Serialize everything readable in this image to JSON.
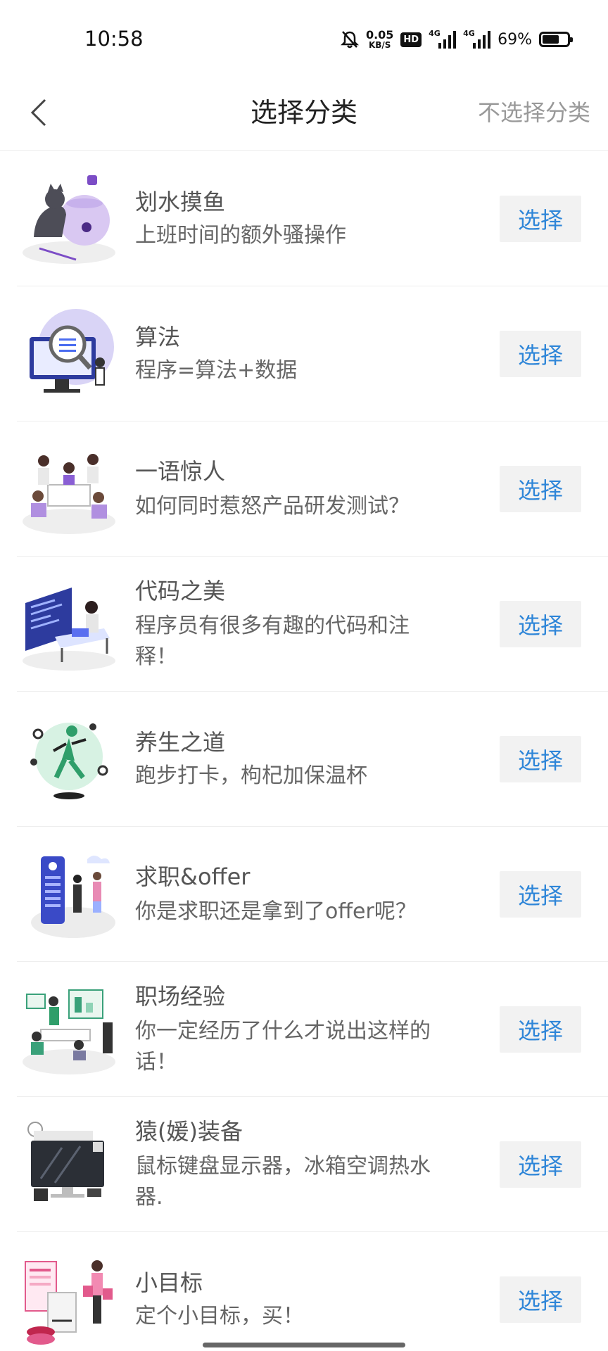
{
  "status": {
    "time": "10:58",
    "speed_value": "0.05",
    "speed_unit": "KB/S",
    "hd": "HD",
    "sig1": "4G",
    "sig2": "4G",
    "battery": "69%",
    "battery_level": 0.69
  },
  "header": {
    "title": "选择分类",
    "skip_label": "不选择分类"
  },
  "categories": [
    {
      "name": "划水摸鱼",
      "desc": "上班时间的额外骚操作",
      "button": "选择"
    },
    {
      "name": "算法",
      "desc": "程序=算法+数据",
      "button": "选择"
    },
    {
      "name": "一语惊人",
      "desc": "如何同时惹怒产品研发测试？",
      "button": "选择"
    },
    {
      "name": "代码之美",
      "desc": "程序员有很多有趣的代码和注释！",
      "button": "选择"
    },
    {
      "name": "养生之道",
      "desc": "跑步打卡，枸杞加保温杯",
      "button": "选择"
    },
    {
      "name": "求职&offer",
      "desc": "你是求职还是拿到了offer呢？",
      "button": "选择"
    },
    {
      "name": "职场经验",
      "desc": "你一定经历了什么才说出这样的话！",
      "button": "选择"
    },
    {
      "name": "猿(媛)装备",
      "desc": "鼠标键盘显示器，冰箱空调热水器.",
      "button": "选择"
    },
    {
      "name": "小目标",
      "desc": "定个小目标，买！",
      "button": "选择"
    }
  ],
  "colors": {
    "accent": "#2f86d8",
    "button_bg": "#f2f2f2"
  }
}
